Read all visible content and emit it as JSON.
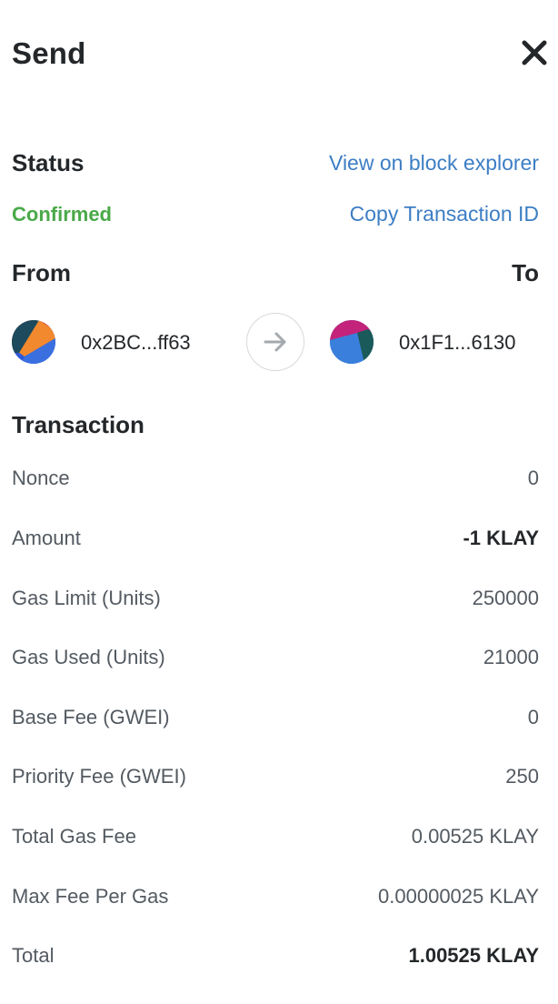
{
  "header": {
    "title": "Send",
    "close_icon": "close-icon"
  },
  "status": {
    "label": "Status",
    "value": "Confirmed",
    "value_color": "#4aa949",
    "view_link": "View on block explorer",
    "copy_link": "Copy Transaction ID",
    "link_color": "#3d7ec4"
  },
  "addresses": {
    "from_label": "From",
    "to_label": "To",
    "from_address": "0x2BC...ff63",
    "to_address": "0x1F1...6130",
    "arrow_icon": "arrow-right-icon"
  },
  "transaction": {
    "label": "Transaction",
    "rows": [
      {
        "label": "Nonce",
        "value": "0"
      },
      {
        "label": "Amount",
        "value": "-1 KLAY"
      },
      {
        "label": "Gas Limit (Units)",
        "value": "250000"
      },
      {
        "label": "Gas Used (Units)",
        "value": "21000"
      },
      {
        "label": "Base Fee (GWEI)",
        "value": "0"
      },
      {
        "label": "Priority Fee (GWEI)",
        "value": "250"
      },
      {
        "label": "Total Gas Fee",
        "value": "0.00525 KLAY"
      },
      {
        "label": "Max Fee Per Gas",
        "value": "0.00000025 KLAY"
      },
      {
        "label": "Total",
        "value": "1.00525 KLAY"
      }
    ]
  }
}
